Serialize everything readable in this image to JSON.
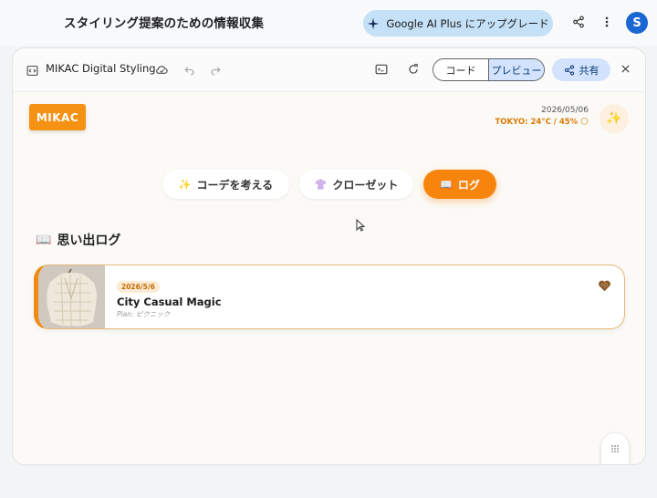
{
  "topbar": {
    "title": "スタイリング提案のための情報収集",
    "upgrade_label": "Google AI Plus にアップグレード",
    "avatar_letter": "S"
  },
  "panel": {
    "doc_title": "MIKAC Digital Styling",
    "code_label": "コード",
    "preview_label": "プレビュー",
    "share_label": "共有"
  },
  "app": {
    "logo": "MIKAC",
    "date": "2026/05/06",
    "weather": "TOKYO: 24°C / 45% 🌕",
    "nav": [
      {
        "emoji": "✨",
        "label": "コーデを考える"
      },
      {
        "emoji": "👚",
        "label": "クローゼット"
      },
      {
        "emoji": "📖",
        "label": "ログ"
      }
    ],
    "section_emoji": "📖",
    "section_title": "思い出ログ",
    "log_entries": [
      {
        "date": "2026/5/6",
        "title": "City Casual Magic",
        "plan": "Plan: ピクニック"
      }
    ]
  },
  "colors": {
    "accent": "#f7850d",
    "upgrade_bg": "#c5e1f7",
    "toggle_selected": "#d3e3fd",
    "avatar": "#1967d2"
  }
}
